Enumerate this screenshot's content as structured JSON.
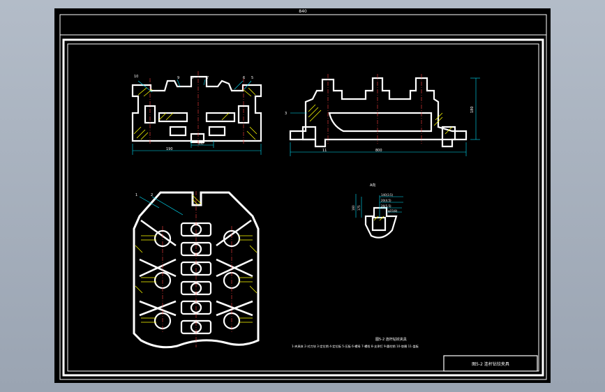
{
  "viewport": {
    "background": "#000000"
  },
  "title_bar": {
    "text": "840"
  },
  "top_view": {
    "labels": [
      "10",
      "9",
      "8",
      "7",
      "6",
      "5"
    ],
    "dim_left": "190",
    "dim_mid": "140"
  },
  "side_view": {
    "label_left": "3",
    "dim_bottom": "800",
    "dim_small": "11",
    "dim_right": "180"
  },
  "plan_view": {
    "labels": [
      "1",
      "2"
    ]
  },
  "detail": {
    "title": "A向",
    "dims": [
      "140(3.5)",
      "20(4.5)",
      "26(5.5)",
      "30(6.5)",
      "70"
    ],
    "note": "φ15(8)",
    "side_dims": [
      "160",
      "175"
    ]
  },
  "caption": {
    "title": "图5-2 连杆钻铰夹具",
    "legend": "1-夹具体 2-对刀块 3-定位销 4-定位板 5-压板 6-螺母 7-螺栓 8-支承钉 9-圆柱销 10-垫圈 11-盖板"
  },
  "title_block": {
    "text": "图5-2 连杆钻铰夹具"
  },
  "colors": {
    "line": "#ffffff",
    "dim": "#00e5ff",
    "hatch": "#ffff00",
    "accent": "#ff4040"
  }
}
